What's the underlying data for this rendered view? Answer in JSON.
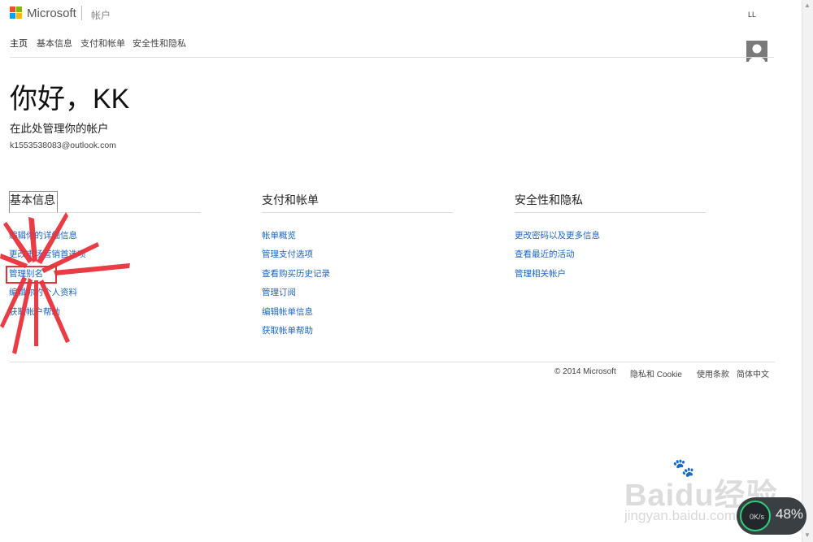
{
  "header": {
    "brand": "Microsoft",
    "section": "帐户",
    "user_initials": "LL",
    "logo_colors": [
      "#f25022",
      "#7fba00",
      "#00a4ef",
      "#ffb900"
    ]
  },
  "nav": {
    "items": [
      {
        "label": "主页",
        "active": true
      },
      {
        "label": "基本信息"
      },
      {
        "label": "支付和帐单"
      },
      {
        "label": "安全性和隐私"
      }
    ]
  },
  "hero": {
    "greeting": "你好，KK",
    "subheading": "在此处管理你的帐户",
    "email": "k1553538083@outlook.com"
  },
  "columns": [
    {
      "title": "基本信息",
      "links": [
        "编辑你的详细信息",
        "更改市场营销首选项",
        "管理别名",
        "编辑你的个人资料",
        "获取帐户帮助"
      ]
    },
    {
      "title": "支付和帐单",
      "links": [
        "帐单概览",
        "管理支付选项",
        "查看购买历史记录",
        "管理订阅",
        "编辑帐单信息",
        "获取帐单帮助"
      ]
    },
    {
      "title": "安全性和隐私",
      "links": [
        "更改密码以及更多信息",
        "查看最近的活动",
        "管理相关帐户"
      ]
    }
  ],
  "footer": {
    "copyright": "© 2014 Microsoft",
    "privacy": "隐私和 Cookie",
    "terms": "使用条款",
    "language": "简体中文"
  },
  "overlay": {
    "watermark": "Baidu经验",
    "watermark_url": "jingyan.baidu.com",
    "speed_value": "0K/s",
    "speed_percent": "48%",
    "accent_color": "#e8323a"
  }
}
